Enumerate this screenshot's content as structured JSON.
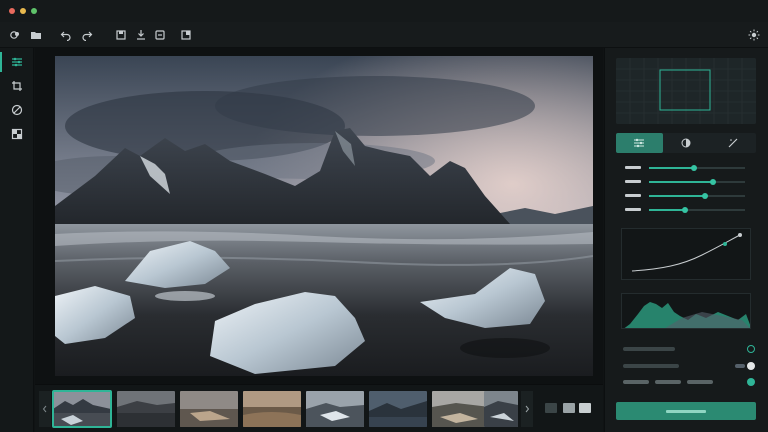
{
  "window": {
    "controls": [
      "close",
      "minimize",
      "maximize"
    ],
    "control_colors": [
      "#e86a5d",
      "#e9b94e",
      "#5fc36a"
    ]
  },
  "toolbar": {
    "left_icons": [
      "layers-icon",
      "folder-icon",
      "undo-icon",
      "redo-icon",
      "save-icon",
      "download-icon",
      "export-icon",
      "fullscreen-icon"
    ],
    "right_icon": "brightness-icon"
  },
  "rail": {
    "tools": [
      "adjust-icon",
      "crop-icon",
      "heal-icon",
      "mask-icon"
    ],
    "active": "adjust-icon"
  },
  "canvas": {
    "subject": "mountains-and-ice-beach-photo"
  },
  "filmstrip": {
    "thumbnail_count": 8,
    "selected_index": 0
  },
  "panel": {
    "tabs": [
      "sliders-tab",
      "color-tab",
      "effects-tab"
    ],
    "active_tab": "sliders-tab",
    "sliders": [
      0.47,
      0.67,
      0.58,
      0.38
    ],
    "toggles": [
      "off",
      "on",
      "on"
    ]
  },
  "colors": {
    "accent": "#2fb597",
    "accent_dark": "#2b8a72",
    "background": "#101314"
  }
}
